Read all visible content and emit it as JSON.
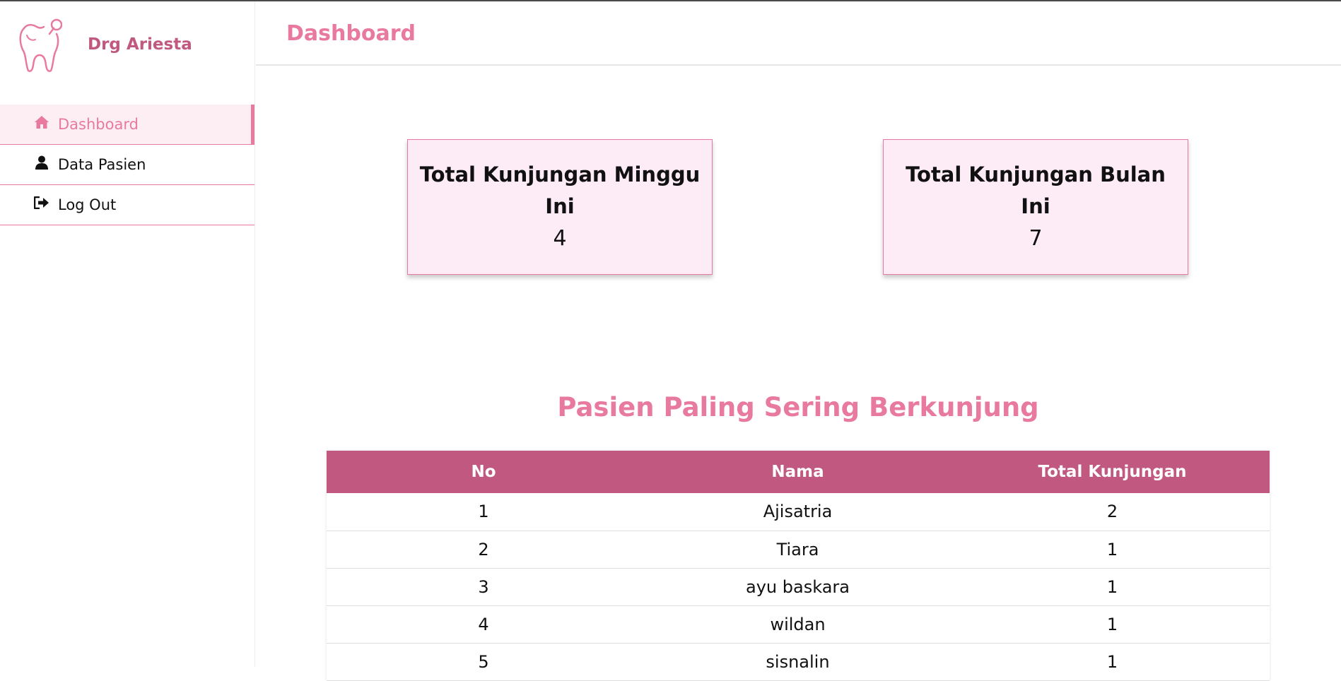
{
  "sidebar": {
    "brand_name": "Drg Ariesta",
    "logo_icon": "tooth-icon",
    "items": [
      {
        "label": "Dashboard",
        "icon": "home-icon",
        "active": true
      },
      {
        "label": "Data Pasien",
        "icon": "user-icon",
        "active": false
      },
      {
        "label": "Log Out",
        "icon": "sign-out-icon",
        "active": false
      }
    ]
  },
  "header": {
    "title": "Dashboard"
  },
  "cards": [
    {
      "title": "Total Kunjungan Minggu Ini",
      "value": "4"
    },
    {
      "title": "Total Kunjungan Bulan Ini",
      "value": "7"
    }
  ],
  "table": {
    "title": "Pasien Paling Sering Berkunjung",
    "columns": [
      "No",
      "Nama",
      "Total Kunjungan"
    ],
    "rows": [
      [
        "1",
        "Ajisatria",
        "2"
      ],
      [
        "2",
        "Tiara",
        "1"
      ],
      [
        "3",
        "ayu baskara",
        "1"
      ],
      [
        "4",
        "wildan",
        "1"
      ],
      [
        "5",
        "sisnalin",
        "1"
      ]
    ]
  },
  "colors": {
    "accent": "#e8799f",
    "brand": "#c0587f",
    "card_bg": "#fdebf6",
    "active_bg": "#fdeef4"
  }
}
